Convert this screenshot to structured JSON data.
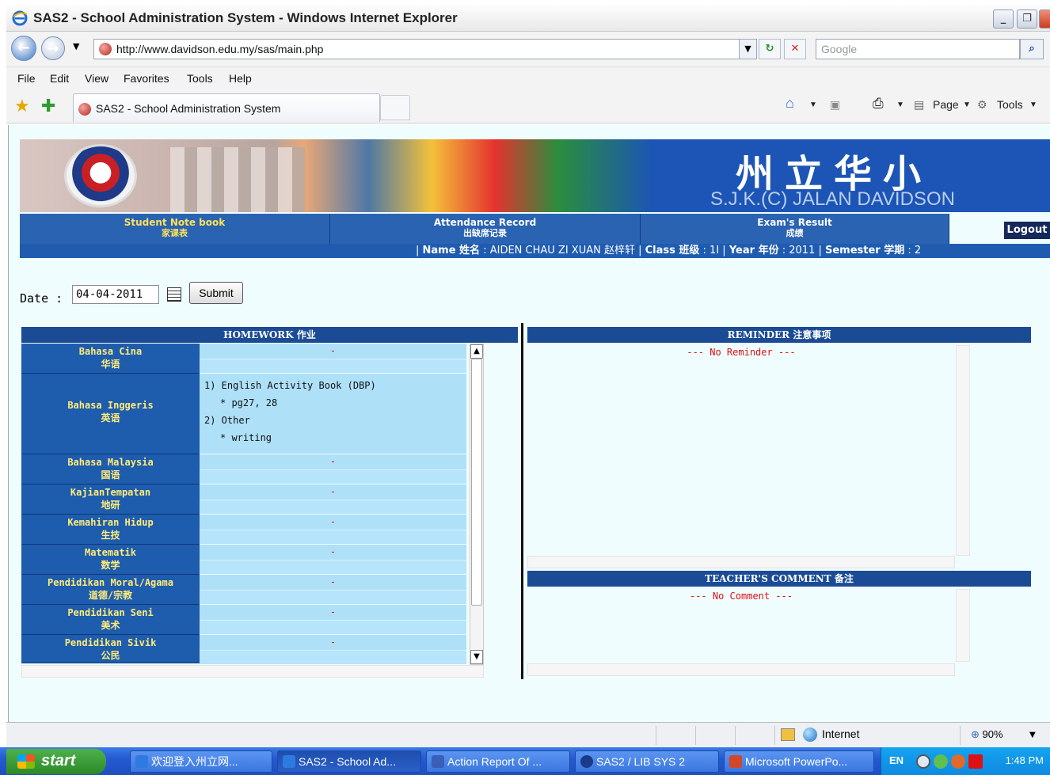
{
  "window": {
    "title": "SAS2 - School Administration System - Windows Internet Explorer",
    "controls": [
      "_",
      "❐",
      "X"
    ]
  },
  "browser": {
    "url": "http://www.davidson.edu.my/sas/main.php",
    "search_placeholder": "Google",
    "menu": [
      "File",
      "Edit",
      "View",
      "Favorites",
      "Tools",
      "Help"
    ],
    "tab_title": "SAS2 - School Administration System",
    "commands": {
      "page": "Page",
      "tools": "Tools"
    }
  },
  "banner": {
    "chinese_name": "州立华小",
    "english_name": "S.J.K.(C) JALAN DAVIDSON"
  },
  "nav": {
    "tabs": [
      {
        "label": "Student Note book",
        "sub": "家课表"
      },
      {
        "label": "Attendance Record",
        "sub": "出缺席记录"
      },
      {
        "label": "Exam's Result",
        "sub": "成绩"
      }
    ],
    "logout": "Logout"
  },
  "student": {
    "name_label": "Name 姓名",
    "name": ": AIDEN CHAU ZI XUAN 赵梓轩",
    "class_label": "Class 班级",
    "class": ": 1I",
    "year_label": "Year 年份",
    "year": ": 2011",
    "semester_label": "Semester 学期",
    "semester": ": 2"
  },
  "date_form": {
    "label": "Date :",
    "value": "04-04-2011",
    "submit": "Submit"
  },
  "homework": {
    "header": "HOMEWORK 作业",
    "subjects": [
      {
        "name": "Bahasa Cina",
        "cn": "华语",
        "value": "-"
      },
      {
        "name": "Bahasa Inggeris",
        "cn": "英语",
        "value": "",
        "details": [
          "1) English Activity Book (DBP)",
          "* pg27, 28",
          "2) Other",
          "* writing"
        ]
      },
      {
        "name": "Bahasa Malaysia",
        "cn": "国语",
        "value": "-"
      },
      {
        "name": "KajianTempatan",
        "cn": "地研",
        "value": "-"
      },
      {
        "name": "Kemahiran Hidup",
        "cn": "生技",
        "value": "-"
      },
      {
        "name": "Matematik",
        "cn": "数学",
        "value": "-"
      },
      {
        "name": "Pendidikan Moral/Agama",
        "cn": "道德/宗教",
        "value": "-"
      },
      {
        "name": "Pendidikan Seni",
        "cn": "美术",
        "value": "-"
      },
      {
        "name": "Pendidikan Sivik",
        "cn": "公民",
        "value": "-"
      }
    ]
  },
  "reminder": {
    "header": "REMINDER 注意事项",
    "empty": "--- No Reminder ---"
  },
  "comment": {
    "header": "TEACHER'S COMMENT 备注",
    "empty": "--- No Comment ---"
  },
  "statusbar": {
    "zone": "Internet",
    "zoom": "90%"
  },
  "taskbar": {
    "start": "start",
    "tasks": [
      "欢迎登入州立网...",
      "SAS2 - School Ad...",
      "Action Report Of ...",
      "SAS2 / LIB SYS 2",
      "Microsoft PowerPo..."
    ],
    "lang": "EN",
    "clock": "1:48 PM"
  }
}
